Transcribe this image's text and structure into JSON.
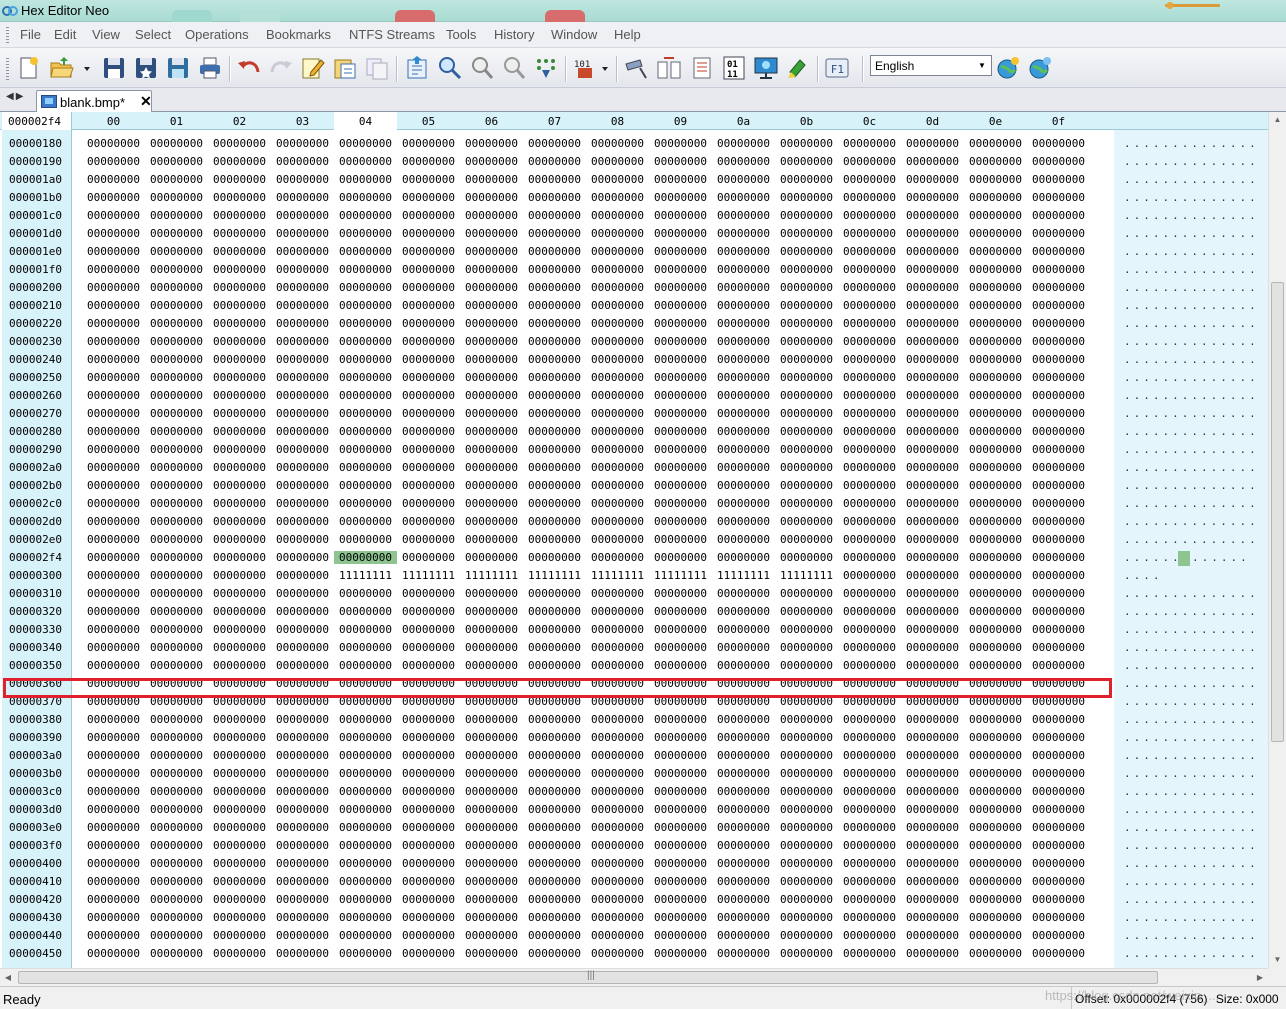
{
  "window": {
    "title": "Hex Editor Neo"
  },
  "menu": [
    "File",
    "Edit",
    "View",
    "Select",
    "Operations",
    "Bookmarks",
    "NTFS Streams",
    "Tools",
    "History",
    "Window",
    "Help"
  ],
  "toolbar": {
    "buttons": [
      "new-file",
      "open-file",
      "open-dropdown",
      "save",
      "save-all",
      "save-as",
      "print",
      "undo",
      "redo",
      "edit",
      "paste-special",
      "copy-special",
      "open-document",
      "find",
      "find-replace",
      "find-next",
      "binary-pattern",
      "encoding-dropdown",
      "select-tool",
      "compare",
      "patch",
      "bits-view",
      "monitor",
      "marker",
      "help-f1",
      "add-globe",
      "refresh-globe"
    ],
    "language": "English"
  },
  "tabs": [
    {
      "label": "blank.bmp*",
      "close": "✕"
    }
  ],
  "grid": {
    "current_offset": "000002f4",
    "columns": [
      "00",
      "01",
      "02",
      "03",
      "04",
      "05",
      "06",
      "07",
      "08",
      "09",
      "0a",
      "0b",
      "0c",
      "0d",
      "0e",
      "0f"
    ],
    "active_column": 4,
    "zero_cell": "00000000",
    "one_cell": "11111111",
    "rows": [
      "00000180",
      "00000190",
      "000001a0",
      "000001b0",
      "000001c0",
      "000001d0",
      "000001e0",
      "000001f0",
      "00000200",
      "00000210",
      "00000220",
      "00000230",
      "00000240",
      "00000250",
      "00000260",
      "00000270",
      "00000280",
      "00000290",
      "000002a0",
      "000002b0",
      "000002c0",
      "000002d0",
      "000002e0",
      "000002f4",
      "00000300",
      "00000310",
      "00000320",
      "00000330",
      "00000340",
      "00000350",
      "00000360",
      "00000370",
      "00000380",
      "00000390",
      "000003a0",
      "000003b0",
      "000003c0",
      "000003d0",
      "000003e0",
      "000003f0",
      "00000400",
      "00000410",
      "00000420",
      "00000430",
      "00000440",
      "00000450"
    ],
    "selected_row": "000002f4",
    "selected_col": 4,
    "highlighted_row": "00000300",
    "ones_columns": [
      4,
      5,
      6,
      7,
      8,
      9,
      10,
      11
    ],
    "text_dots": "..............",
    "text_dots_short": "....",
    "text_dots_partial_left": ".......",
    "text_dots_partial_right": "......"
  },
  "status": {
    "ready": "Ready",
    "offset": "Offset: 0x000002f4 (756)",
    "size": "Size: 0x000",
    "watermark": "https://blog.csdn.net/weixin_..."
  }
}
